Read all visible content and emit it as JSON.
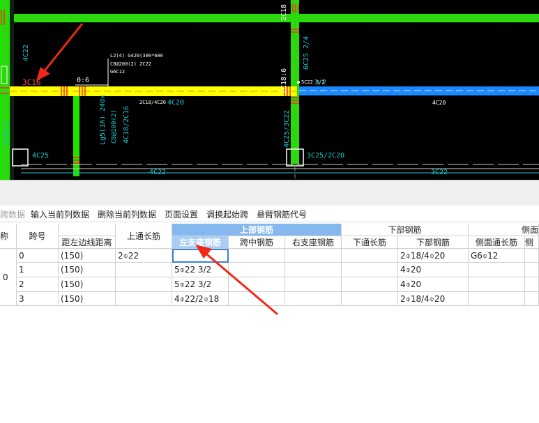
{
  "cad": {
    "labels": {
      "top_vertical": "2C18",
      "left_vertical": "4C22",
      "beam_top_left": "3C16",
      "ratio": "0:6",
      "beam_spec_1": "L2(4) G420(300*600",
      "beam_spec_2": "C8@200(2) 2C22",
      "beam_spec_3": "G6C12",
      "middle_right_v1": "2C18:6",
      "middle_right_v2": "6C25 2/4",
      "beam_right": "5C22 3/2",
      "beam_left_lower": "2C18/4C20",
      "beam_left_bottom": "4C20",
      "right_beam_bottom": "4C20",
      "left_col_lower": "3C25/2",
      "lg_spec": "Lg5(1A) 240x",
      "lg_spec_2": "C8@100(2)",
      "lg_spec_3": "4C18/2C16",
      "lower_left_beam": "4C25",
      "mid_col_lower": "4C25/3C22",
      "lower_right_beam": "3C25/2C20",
      "bottom_left": "4C22",
      "bottom_right": "3C22"
    },
    "colors": {
      "green": "#22e000",
      "yellow": "#ffff00",
      "blue": "#1b88ff",
      "red": "#ff2a1a",
      "cyan": "#18c8d0",
      "white": "#ffffff"
    }
  },
  "toolbar": {
    "items": [
      {
        "label": "跨数据",
        "disabled": true
      },
      {
        "label": "输入当前列数据",
        "disabled": false
      },
      {
        "label": "删除当前列数据",
        "disabled": false
      },
      {
        "label": "页面设置",
        "disabled": false
      },
      {
        "label": "调换起始跨",
        "disabled": false
      },
      {
        "label": "悬臂钢筋代号",
        "disabled": false
      }
    ]
  },
  "grid": {
    "headers": {
      "name_partial": "称",
      "span_no": "跨号",
      "left_edge_dist": "距左边线距离",
      "top_through": "上通长筋",
      "upper_group": "上部钢筋",
      "left_support": "左支座钢筋",
      "mid_span": "跨中钢筋",
      "right_support": "右支座钢筋",
      "lower_group": "下部钢筋",
      "bottom_through": "下通长筋",
      "bottom_bar": "下部钢筋",
      "side_through": "侧面通长筋",
      "side_group_partial": "侧面",
      "side_partial": "侧"
    },
    "rows": [
      {
        "span": "0",
        "dist": "(150)",
        "top_through": "2⌽22",
        "left_support": "",
        "mid": "",
        "right_support": "",
        "bottom_through": "",
        "bottom": "2⌽18/4⌽20",
        "side": "G6⌽12"
      },
      {
        "span": "1",
        "dist": "(150)",
        "top_through": "",
        "left_support": "5⌽22 3/2",
        "mid": "",
        "right_support": "",
        "bottom_through": "",
        "bottom": "4⌽20",
        "side": ""
      },
      {
        "span": "2",
        "dist": "(150)",
        "top_through": "",
        "left_support": "5⌽22 3/2",
        "mid": "",
        "right_support": "",
        "bottom_through": "",
        "bottom": "4⌽20",
        "side": ""
      },
      {
        "span": "3",
        "dist": "(150)",
        "top_through": "",
        "left_support": "4⌽22/2⌽18",
        "mid": "",
        "right_support": "",
        "bottom_through": "",
        "bottom": "2⌽18/4⌽20",
        "side": ""
      }
    ],
    "left_marker": "0"
  },
  "annotation_colors": {
    "arrow": "#f02818"
  }
}
